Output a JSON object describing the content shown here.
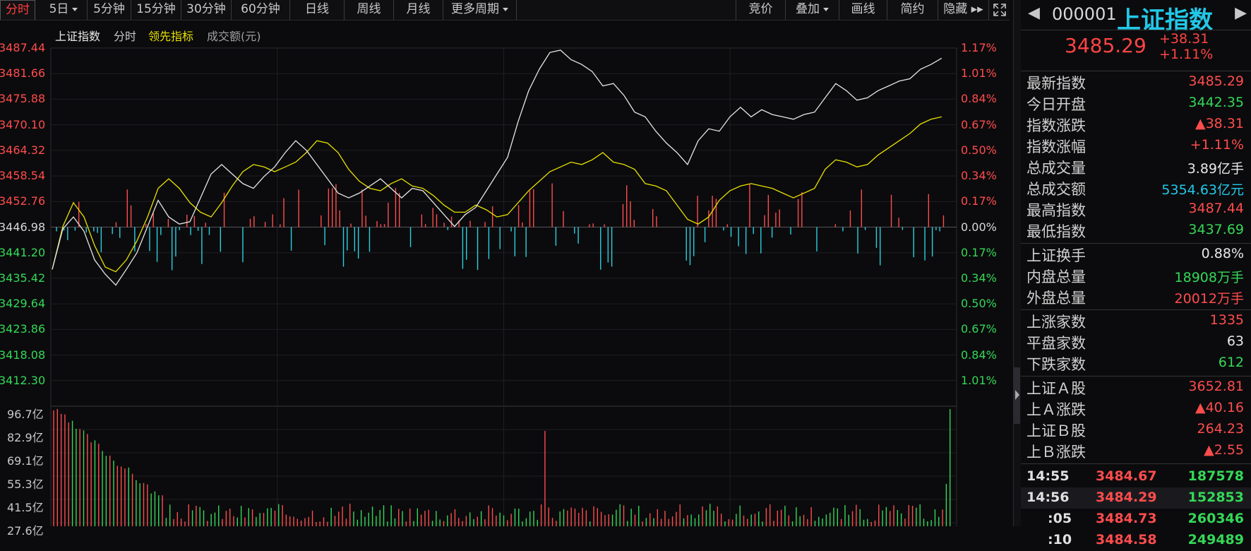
{
  "toolbar": {
    "tabs": [
      {
        "label": "分时",
        "active": true
      },
      {
        "label": "5日",
        "dropdown": true
      },
      {
        "label": "5分钟"
      },
      {
        "label": "15分钟"
      },
      {
        "label": "30分钟"
      },
      {
        "label": "60分钟"
      },
      {
        "label": "日线"
      },
      {
        "label": "周线"
      },
      {
        "label": "月线"
      },
      {
        "label": "更多周期",
        "dropdown": true
      }
    ],
    "right_buttons": [
      {
        "label": "竞价"
      },
      {
        "label": "叠加",
        "dropdown": true
      },
      {
        "label": "画线"
      },
      {
        "label": "简约"
      },
      {
        "label": "隐藏 ▸▸"
      }
    ],
    "fullscreen_icon": "expand-icon"
  },
  "legend": {
    "items": [
      {
        "label": "上证指数",
        "color": "#e8e8e8"
      },
      {
        "label": "分时",
        "color": "#c8c8c8"
      },
      {
        "label": "领先指标",
        "color": "#e8e000"
      },
      {
        "label": "成交额(元)",
        "color": "#a0a0a0"
      }
    ]
  },
  "chart": {
    "price_labels": [
      "3487.44",
      "3481.66",
      "3475.88",
      "3470.10",
      "3464.32",
      "3458.54",
      "3452.76",
      "3446.98",
      "3441.20",
      "3435.42",
      "3429.64",
      "3423.86",
      "3418.08",
      "3412.30"
    ],
    "pct_labels": [
      "1.17%",
      "1.01%",
      "0.84%",
      "0.67%",
      "0.50%",
      "0.34%",
      "0.17%",
      "0.00%",
      "0.17%",
      "0.34%",
      "0.50%",
      "0.67%",
      "0.84%",
      "1.01%"
    ],
    "volume_labels": [
      "96.7亿",
      "82.9亿",
      "69.1亿",
      "55.3亿",
      "41.5亿",
      "27.6亿"
    ],
    "colors": {
      "up": "#ff4c4c",
      "down": "#2ccfe0",
      "flat": "#d8d8d8",
      "index": "#e6e6e6",
      "leading": "#e8e000"
    }
  },
  "chart_data": {
    "type": "line",
    "title": "上证指数 分时",
    "x": "minutes 09:30–15:00 (~240 points, sampled)",
    "ylim": [
      3412.3,
      3487.44
    ],
    "prev_close": 3446.98,
    "series": [
      {
        "name": "上证指数",
        "values": [
          3441.0,
          3449.5,
          3452.0,
          3449.0,
          3443.0,
          3440.0,
          3437.7,
          3441.0,
          3444.5,
          3450.0,
          3455.5,
          3452.0,
          3450.5,
          3451.0,
          3456.0,
          3461.0,
          3463.0,
          3461.0,
          3459.0,
          3458.0,
          3460.5,
          3462.5,
          3465.5,
          3468.0,
          3466.0,
          3463.0,
          3460.0,
          3457.0,
          3456.0,
          3457.0,
          3458.5,
          3460.0,
          3458.0,
          3456.0,
          3458.0,
          3457.5,
          3455.0,
          3452.5,
          3450.0,
          3452.5,
          3454.0,
          3457.5,
          3461.0,
          3464.5,
          3472.0,
          3478.5,
          3483.0,
          3486.5,
          3487.0,
          3485.0,
          3484.0,
          3482.5,
          3479.5,
          3480.0,
          3477.5,
          3474.0,
          3473.0,
          3470.0,
          3467.5,
          3465.5,
          3463.0,
          3468.0,
          3470.5,
          3470.0,
          3473.0,
          3475.0,
          3473.0,
          3474.5,
          3473.5,
          3473.0,
          3472.5,
          3473.5,
          3474.0,
          3477.0,
          3480.0,
          3478.5,
          3476.5,
          3477.0,
          3478.5,
          3479.5,
          3480.5,
          3481.0,
          3483.0,
          3484.0,
          3485.3
        ]
      },
      {
        "name": "领先指标",
        "values": [
          3441.0,
          3450.0,
          3455.0,
          3452.0,
          3446.0,
          3441.5,
          3440.5,
          3443.0,
          3447.0,
          3452.0,
          3458.0,
          3460.0,
          3458.0,
          3455.0,
          3453.0,
          3452.0,
          3455.0,
          3458.5,
          3461.5,
          3463.0,
          3462.5,
          3461.5,
          3462.5,
          3463.5,
          3465.5,
          3468.0,
          3467.5,
          3465.5,
          3462.0,
          3459.5,
          3458.0,
          3457.5,
          3459.0,
          3460.0,
          3458.5,
          3458.0,
          3456.5,
          3454.5,
          3453.0,
          3453.0,
          3454.5,
          3453.5,
          3452.0,
          3452.5,
          3455.0,
          3457.5,
          3459.5,
          3461.5,
          3462.5,
          3463.5,
          3463.0,
          3464.0,
          3465.5,
          3463.5,
          3463.0,
          3462.0,
          3459.0,
          3458.5,
          3457.5,
          3454.5,
          3451.5,
          3450.5,
          3452.0,
          3455.5,
          3457.5,
          3458.5,
          3459.0,
          3458.5,
          3458.0,
          3457.0,
          3456.0,
          3457.0,
          3458.0,
          3462.0,
          3464.0,
          3463.5,
          3462.5,
          3463.0,
          3465.0,
          3466.5,
          3468.0,
          3469.5,
          3471.5,
          3472.5,
          3473.0
        ]
      }
    ]
  },
  "panel": {
    "code": "000001",
    "name": "上证指数",
    "price": "3485.29",
    "change": "+38.31",
    "change_pct": "+1.11%",
    "stats": [
      {
        "label": "最新指数",
        "value": "3485.29",
        "color": "#ff4c4c"
      },
      {
        "label": "今日开盘",
        "value": "3442.35",
        "color": "#34d858"
      },
      {
        "label": "指数涨跌",
        "value": "▲38.31",
        "color": "#ff4c4c"
      },
      {
        "label": "指数涨幅",
        "value": "+1.11%",
        "color": "#ff4c4c"
      },
      {
        "label": "总成交量",
        "value": "3.89亿手",
        "color": "#e8e8e8"
      },
      {
        "label": "总成交额",
        "value": "5354.63亿元",
        "color": "#22c8e8"
      },
      {
        "label": "最高指数",
        "value": "3487.44",
        "color": "#ff4c4c"
      },
      {
        "label": "最低指数",
        "value": "3437.69",
        "color": "#34d858"
      }
    ],
    "stats2": [
      {
        "label": "上证换手",
        "value": "0.88%",
        "color": "#e8e8e8"
      },
      {
        "label": "内盘总量",
        "value": "18908万手",
        "color": "#34d858"
      },
      {
        "label": "外盘总量",
        "value": "20012万手",
        "color": "#ff4c4c"
      }
    ],
    "stats3": [
      {
        "label": "上涨家数",
        "value": "1335",
        "color": "#ff4c4c"
      },
      {
        "label": "平盘家数",
        "value": "63",
        "color": "#e8e8e8"
      },
      {
        "label": "下跌家数",
        "value": "612",
        "color": "#34d858"
      }
    ],
    "stats4": [
      {
        "label": "上证Ａ股",
        "value": "3652.81",
        "color": "#ff4c4c"
      },
      {
        "label": "上Ａ涨跌",
        "value": "▲40.16",
        "color": "#ff4c4c"
      },
      {
        "label": "上证Ｂ股",
        "value": "264.23",
        "color": "#ff4c4c"
      },
      {
        "label": "上Ｂ涨跌",
        "value": "▲2.55",
        "color": "#ff4c4c"
      }
    ],
    "ticks": [
      {
        "time": "14:55",
        "price": "3484.67",
        "vol": "187578"
      },
      {
        "time": "14:56",
        "price": "3484.29",
        "vol": "152853"
      },
      {
        "time": ":05",
        "price": "3484.73",
        "vol": "260346"
      },
      {
        "time": ":10",
        "price": "3484.58",
        "vol": "249489"
      }
    ]
  }
}
